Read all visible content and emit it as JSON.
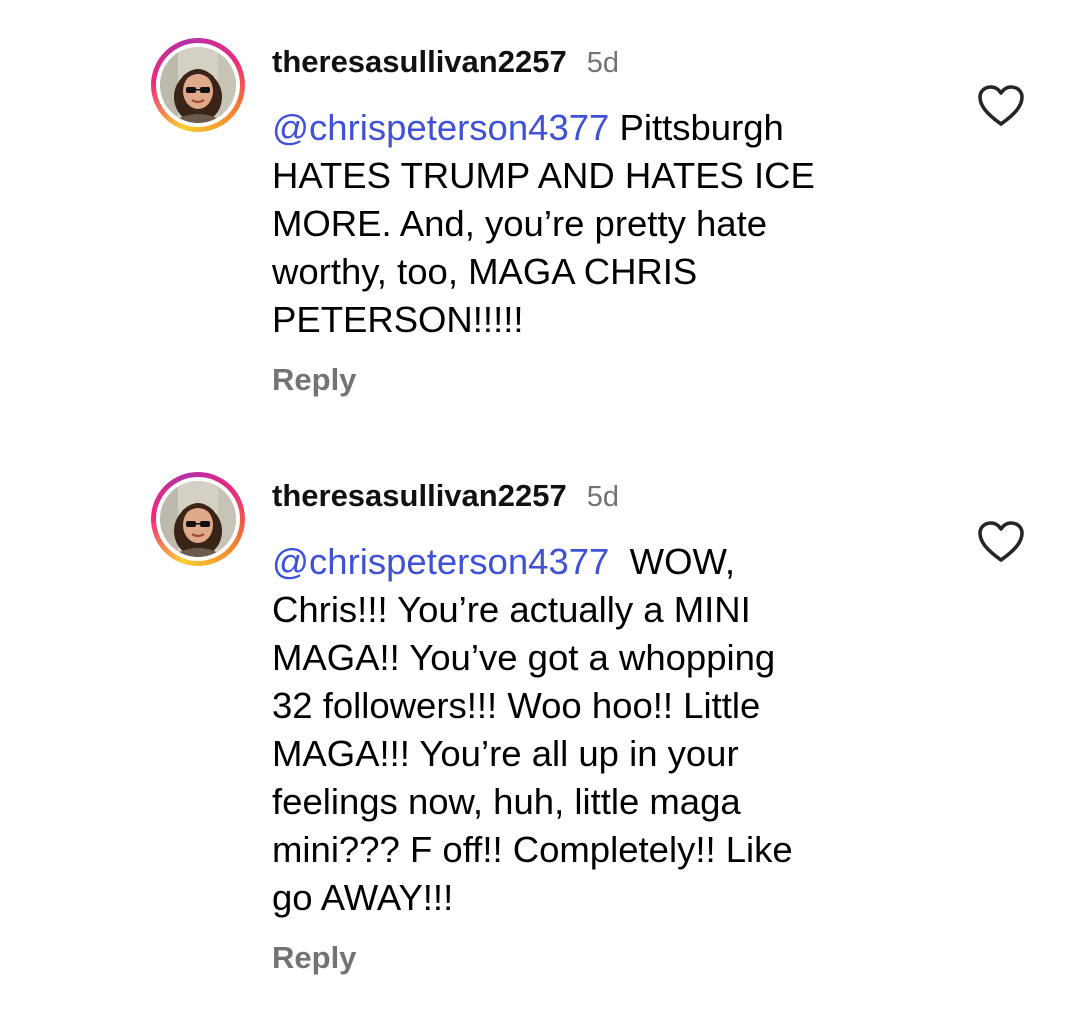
{
  "comments": [
    {
      "username": "theresasullivan2257",
      "time": "5d",
      "mention": "@chrispeterson4377",
      "text_lines": [
        " Pittsburgh",
        "HATES TRUMP AND HATES ICE",
        "MORE. And, you’re pretty hate",
        "worthy, too, MAGA CHRIS",
        "PETERSON!!!!!"
      ],
      "reply_label": "Reply"
    },
    {
      "username": "theresasullivan2257",
      "time": "5d",
      "mention": "@chrispeterson4377",
      "text_lines": [
        "  WOW,",
        "Chris!!! You’re actually a MINI",
        "MAGA!! You’ve got a whopping",
        "32 followers!!! Woo hoo!! Little",
        "MAGA!!! You’re all up in your",
        "feelings now, huh, little maga",
        "mini??? F off!! Completely!! Like",
        "go AWAY!!!"
      ],
      "reply_label": "Reply"
    }
  ],
  "icons": {
    "like": "heart-outline-icon",
    "threads_mention": "threads-icon"
  },
  "colors": {
    "mention": "#3f51d6",
    "secondary_text": "#737373"
  }
}
